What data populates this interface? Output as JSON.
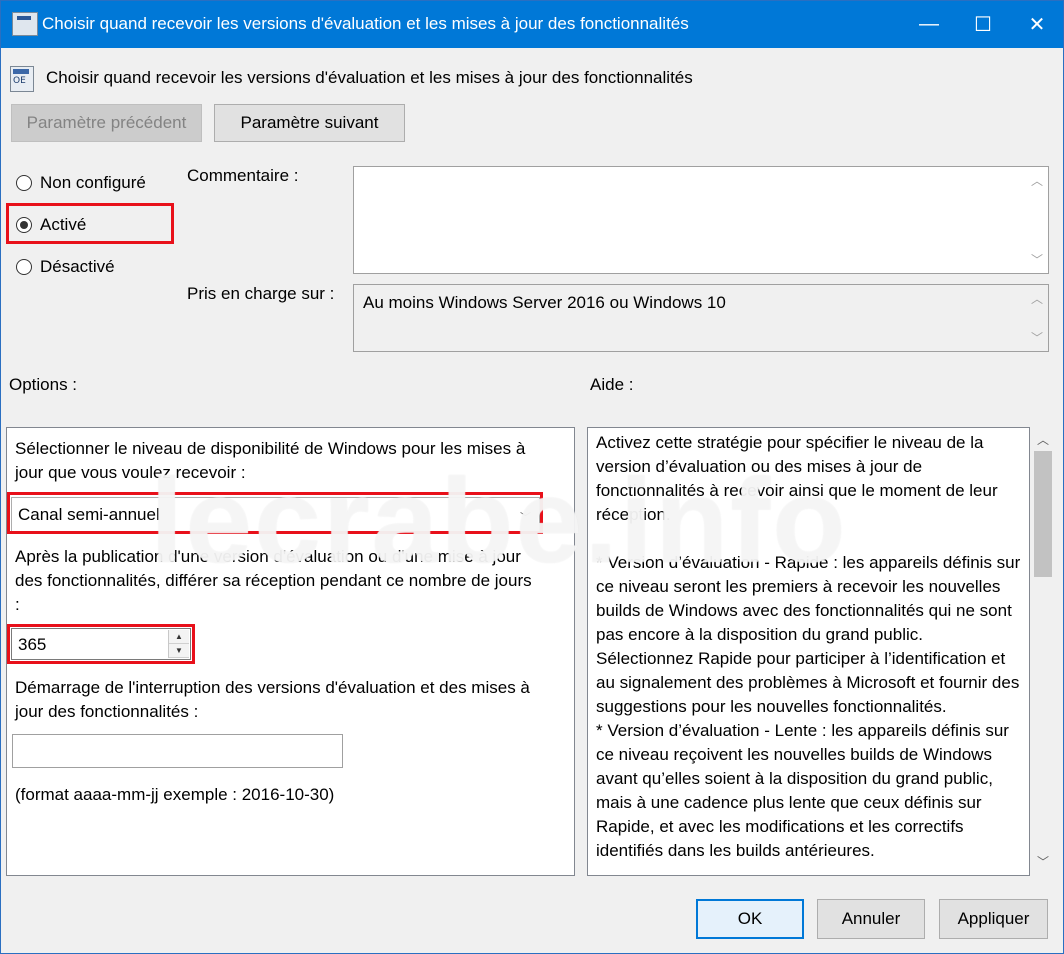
{
  "window": {
    "title": "Choisir quand recevoir les versions d'évaluation et les mises à jour des fonctionnalités",
    "minimize_glyph": "—",
    "maximize_glyph": "☐",
    "close_glyph": "✕"
  },
  "header": {
    "policy_title": "Choisir quand recevoir les versions d'évaluation et les mises à jour des fonctionnalités",
    "icon": "policy-setting-icon"
  },
  "nav": {
    "prev_label": "Paramètre précédent",
    "next_label": "Paramètre suivant"
  },
  "state": {
    "options": [
      {
        "label": "Non configuré",
        "checked": false
      },
      {
        "label": "Activé",
        "checked": true
      },
      {
        "label": "Désactivé",
        "checked": false
      }
    ]
  },
  "comment": {
    "label": "Commentaire :",
    "value": ""
  },
  "supported": {
    "label": "Pris en charge sur :",
    "value": "Au moins Windows Server 2016 ou Windows 10"
  },
  "options_panel": {
    "header": "Options :",
    "level_label": "Sélectionner le niveau de disponibilité de Windows pour les mises à jour que vous voulez recevoir :",
    "level_value": "Canal semi-annuel",
    "defer_label": "Après la publication d'une version d'évaluation ou d'une mise à jour des fonctionnalités, différer sa réception pendant ce nombre de jours :",
    "defer_value": "365",
    "pause_label": "Démarrage de l'interruption des versions d'évaluation et des mises à jour des fonctionnalités :",
    "pause_value": "",
    "format_hint": "(format aaaa-mm-jj exemple : 2016-10-30)"
  },
  "help_panel": {
    "header": "Aide :",
    "paragraphs": [
      "Activez cette stratégie pour spécifier le niveau de la version d’évaluation ou des mises à jour de fonctionnalités à recevoir ainsi que le moment de leur réception.",
      "",
      "* Version d’évaluation - Rapide : les appareils définis sur ce niveau seront les premiers à recevoir les nouvelles builds de Windows avec des fonctionnalités qui ne sont pas encore à la disposition du grand public. Sélectionnez Rapide pour participer à l’identification et au signalement des problèmes à Microsoft et fournir des suggestions pour les nouvelles fonctionnalités.",
      "* Version d’évaluation - Lente : les appareils définis sur ce niveau reçoivent les nouvelles builds de Windows avant qu’elles soient à la disposition du grand public, mais à une cadence plus lente que ceux définis sur Rapide, et avec les modifications et les correctifs identifiés dans les builds antérieures."
    ]
  },
  "footer": {
    "ok_label": "OK",
    "cancel_label": "Annuler",
    "apply_label": "Appliquer"
  },
  "watermark": "lecrabe.info",
  "colors": {
    "titlebar": "#0078d7",
    "highlight": "#e8101a"
  }
}
